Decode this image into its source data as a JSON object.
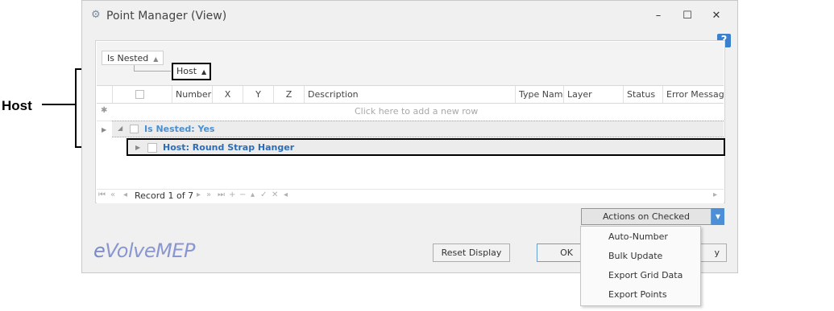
{
  "callout": {
    "label": "Host"
  },
  "window": {
    "title": "Point Manager (View)",
    "controls": {
      "minimize": "–",
      "maximize": "☐",
      "close": "✕"
    },
    "help": "?"
  },
  "grid": {
    "group_chips": {
      "level1": "Is Nested",
      "level2": "Host"
    },
    "columns": [
      "Number",
      "X",
      "Y",
      "Z",
      "Description",
      "Type Name",
      "Layer",
      "Status",
      "Error Message"
    ],
    "new_row_text": "Click here to add a new row",
    "group_rows": [
      {
        "text": "Is Nested: Yes"
      },
      {
        "text": "Host: Round Strap Hanger"
      }
    ],
    "navigator": {
      "record_text": "Record 1 of 7"
    }
  },
  "actions": {
    "button_label": "Actions on Checked"
  },
  "menu": {
    "items": [
      "Auto-Number",
      "Bulk Update",
      "Export Grid Data",
      "Export Points"
    ]
  },
  "footer": {
    "logo_prefix": "e",
    "logo_rest": "VolveMEP",
    "reset_label": "Reset Display",
    "ok_label": "OK",
    "apply_partial": "y"
  },
  "colors": {
    "accent": "#4d8fd6",
    "group_text": "#4a8fd0",
    "logo": "#8a96cf"
  }
}
